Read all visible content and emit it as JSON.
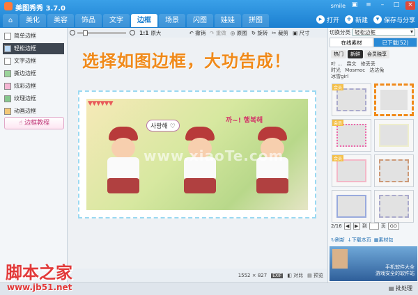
{
  "app": {
    "title": "美图秀秀 3.7.0",
    "user": "smile"
  },
  "tabs": [
    {
      "label": "美化"
    },
    {
      "label": "美容"
    },
    {
      "label": "饰品"
    },
    {
      "label": "文字"
    },
    {
      "label": "边框",
      "active": true
    },
    {
      "label": "场景"
    },
    {
      "label": "闪图"
    },
    {
      "label": "娃娃"
    },
    {
      "label": "拼图"
    }
  ],
  "header_actions": {
    "open": "打开",
    "new": "新建",
    "save_share": "保存与分享"
  },
  "sidebar": {
    "items": [
      {
        "label": "简单边框",
        "active": false
      },
      {
        "label": "轻松边框",
        "active": true
      },
      {
        "label": "文字边框",
        "active": false
      },
      {
        "label": "撕边边框",
        "active": false
      },
      {
        "label": "炫彩边框",
        "active": false
      },
      {
        "label": "纹理边框",
        "active": false
      },
      {
        "label": "动画边框",
        "active": false
      }
    ],
    "tutorial": "边框教程"
  },
  "toolbar": {
    "ratio": "1:1",
    "original_size": "原大",
    "undo": "撤销",
    "redo": "重做",
    "original": "原图",
    "rotate": "旋转",
    "crop": "裁剪",
    "size": "尺寸"
  },
  "canvas": {
    "headline": "选择如图边框，大功告成！",
    "photo_text_1": "사랑해 ♡",
    "photo_text_2": "까~! 행복해",
    "watermark": "www.xiaoTe.com",
    "pennants": "▼▼▼▼▼▼"
  },
  "status": {
    "dimensions": "1552 × 827",
    "exif": "EXIF",
    "compare": "对比",
    "preview": "预览"
  },
  "right_panel": {
    "switch_label": "切换分类",
    "category": "轻松边框",
    "tab_online": "在线素材",
    "tab_downloaded": "已下载(52)",
    "subtabs": [
      {
        "label": "热门",
        "active": false
      },
      {
        "label": "新鲜",
        "active": true
      },
      {
        "label": "会员独享",
        "active": false
      }
    ],
    "names": [
      "叶 …",
      "霖文",
      "修丢丢",
      "时光",
      "Mosmoc",
      "达达兔",
      "冰雪girl"
    ],
    "thumb_tag": "会员",
    "pagination": {
      "page": "2/16",
      "goto_label": "到",
      "page_suffix": "页",
      "go": "GO"
    },
    "links": {
      "refresh": "刷新",
      "download_page": "下载本页",
      "material_pack": "素材包"
    },
    "banner_text_1": "手机软件大全",
    "banner_text_2": "游戏安全的软件站"
  },
  "footer": {
    "batch": "批处理"
  },
  "jb51": {
    "title": "脚本之家",
    "url": "www.jb51.net"
  },
  "colors": {
    "accent": "#1b7fd0",
    "headline": "#f08a1a",
    "selection": "#f08a1a",
    "jb51": "#e23a3a"
  }
}
